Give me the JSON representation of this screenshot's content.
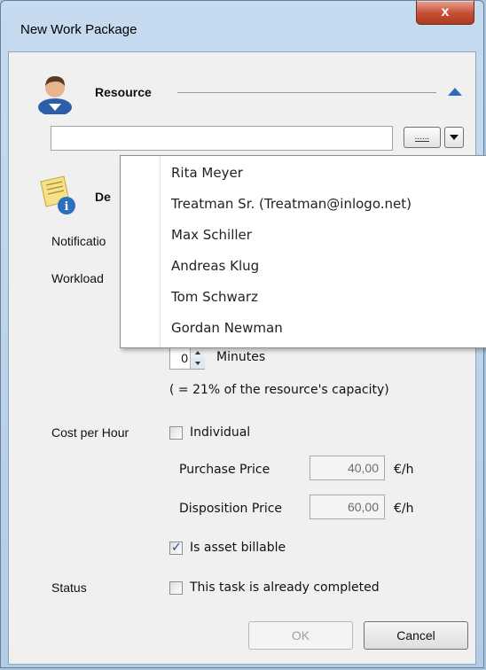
{
  "window": {
    "title": "New Work Package",
    "close_label": "x"
  },
  "resource": {
    "section_title": "Resource",
    "input_value": "",
    "browse_label": "......",
    "dropdown_items": [
      "Rita Meyer",
      "Treatman Sr. (Treatman@inlogo.net)",
      "Max Schiller",
      "Andreas Klug",
      "Tom Schwarz",
      "Gordan Newman"
    ]
  },
  "details": {
    "section_title_partial": "De"
  },
  "notification": {
    "label_partial": "Notificatio"
  },
  "workload": {
    "label_partial": "Workload",
    "minutes_value": "0",
    "minutes_label": "Minutes",
    "capacity_text": "( = 21% of the resource's capacity)"
  },
  "cost": {
    "label": "Cost per Hour",
    "individual_label": "Individual",
    "purchase_label": "Purchase Price",
    "purchase_value": "40,00",
    "purchase_unit": "€/h",
    "disposition_label": "Disposition Price",
    "disposition_value": "60,00",
    "disposition_unit": "€/h",
    "billable_label": "Is asset billable"
  },
  "status": {
    "label": "Status",
    "completed_label": "This task is already completed"
  },
  "buttons": {
    "ok": "OK",
    "cancel": "Cancel"
  },
  "colors": {
    "accent": "#2f6fb8",
    "close": "#c64d33"
  }
}
